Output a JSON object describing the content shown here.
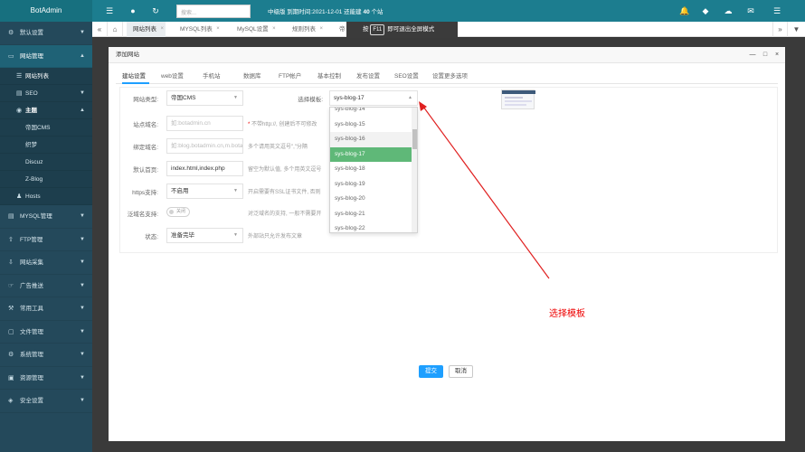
{
  "app": {
    "brand": "BotAdmin"
  },
  "header": {
    "search_placeholder": "搜索...",
    "notice_prefix": "中级版 到期时间:2021-12-01 还能建",
    "notice_count": "40",
    "notice_suffix": "个站"
  },
  "sidebar": {
    "items": [
      {
        "label": "默认设置"
      },
      {
        "label": "网站管理"
      },
      {
        "label": "网站列表"
      },
      {
        "label": "SEO"
      },
      {
        "label": "主题"
      },
      {
        "label": "帝国CMS"
      },
      {
        "label": "织梦"
      },
      {
        "label": "Discuz"
      },
      {
        "label": "Z-Blog"
      },
      {
        "label": "Hosts"
      },
      {
        "label": "MYSQL管理"
      },
      {
        "label": "FTP管理"
      },
      {
        "label": "网站采集"
      },
      {
        "label": "广告推送"
      },
      {
        "label": "常用工具"
      },
      {
        "label": "文件管理"
      },
      {
        "label": "系统管理"
      },
      {
        "label": "资源管理"
      },
      {
        "label": "安全设置"
      }
    ]
  },
  "tabs": [
    {
      "label": "网站列表"
    },
    {
      "label": "MYSQL列表"
    },
    {
      "label": "MySQL设置"
    },
    {
      "label": "规则列表"
    },
    {
      "label": "帝"
    }
  ],
  "fullscreen_notice": {
    "prefix": "按",
    "key": "F11",
    "text": "即可退出全屏模式"
  },
  "dialog": {
    "title": "添加网站",
    "tabs": [
      {
        "label": "建站设置"
      },
      {
        "label": "web设置"
      },
      {
        "label": "手机站"
      },
      {
        "label": "数据库"
      },
      {
        "label": "FTP帐户"
      },
      {
        "label": "基本控制"
      },
      {
        "label": "发布设置"
      },
      {
        "label": "SEO设置"
      },
      {
        "label": "设置更多选项"
      }
    ],
    "form": {
      "site_type": {
        "label": "网站类型:",
        "value": "帝国CMS"
      },
      "template": {
        "label": "选择模板:",
        "value": "sys-blog-17"
      },
      "main_domain": {
        "label": "站点域名:",
        "placeholder": "如:botadmin.cn",
        "note_required": "*",
        "note": "不带http://, 创建后不可修改"
      },
      "bind_domain": {
        "label": "绑定域名:",
        "placeholder": "如:blog.botadmin.cn,m.botadmin.cn",
        "note": "多个请用英文逗号\",\"分隔"
      },
      "index_page": {
        "label": "默认首页:",
        "value": "index.html,index.php",
        "note": "留空为默认值, 多个用英文逗号"
      },
      "https": {
        "label": "https支持:",
        "value": "不启用",
        "note": "开启需要有SSL证书文件, 否则"
      },
      "wildcard": {
        "label": "泛域名支持:",
        "toggle_text": "关闭",
        "note": "对泛域名的支持, 一般不需要开"
      },
      "status": {
        "label": "状态:",
        "value": "准备完毕",
        "note": "外部站只允许发布文章"
      }
    },
    "dropdown_options": [
      "sys-blog-14",
      "sys-blog-15",
      "sys-blog-16",
      "sys-blog-17",
      "sys-blog-18",
      "sys-blog-19",
      "sys-blog-20",
      "sys-blog-21",
      "sys-blog-22"
    ],
    "buttons": {
      "submit": "提交",
      "cancel": "取消"
    }
  },
  "annotation": {
    "text": "选择模板",
    "color": "#e02020"
  },
  "colors": {
    "topbar": "#1c7d8f",
    "sidebar": "#24495b",
    "active": "#27a8c5",
    "selected_option": "#5fb878",
    "primary": "#1e9fff"
  }
}
